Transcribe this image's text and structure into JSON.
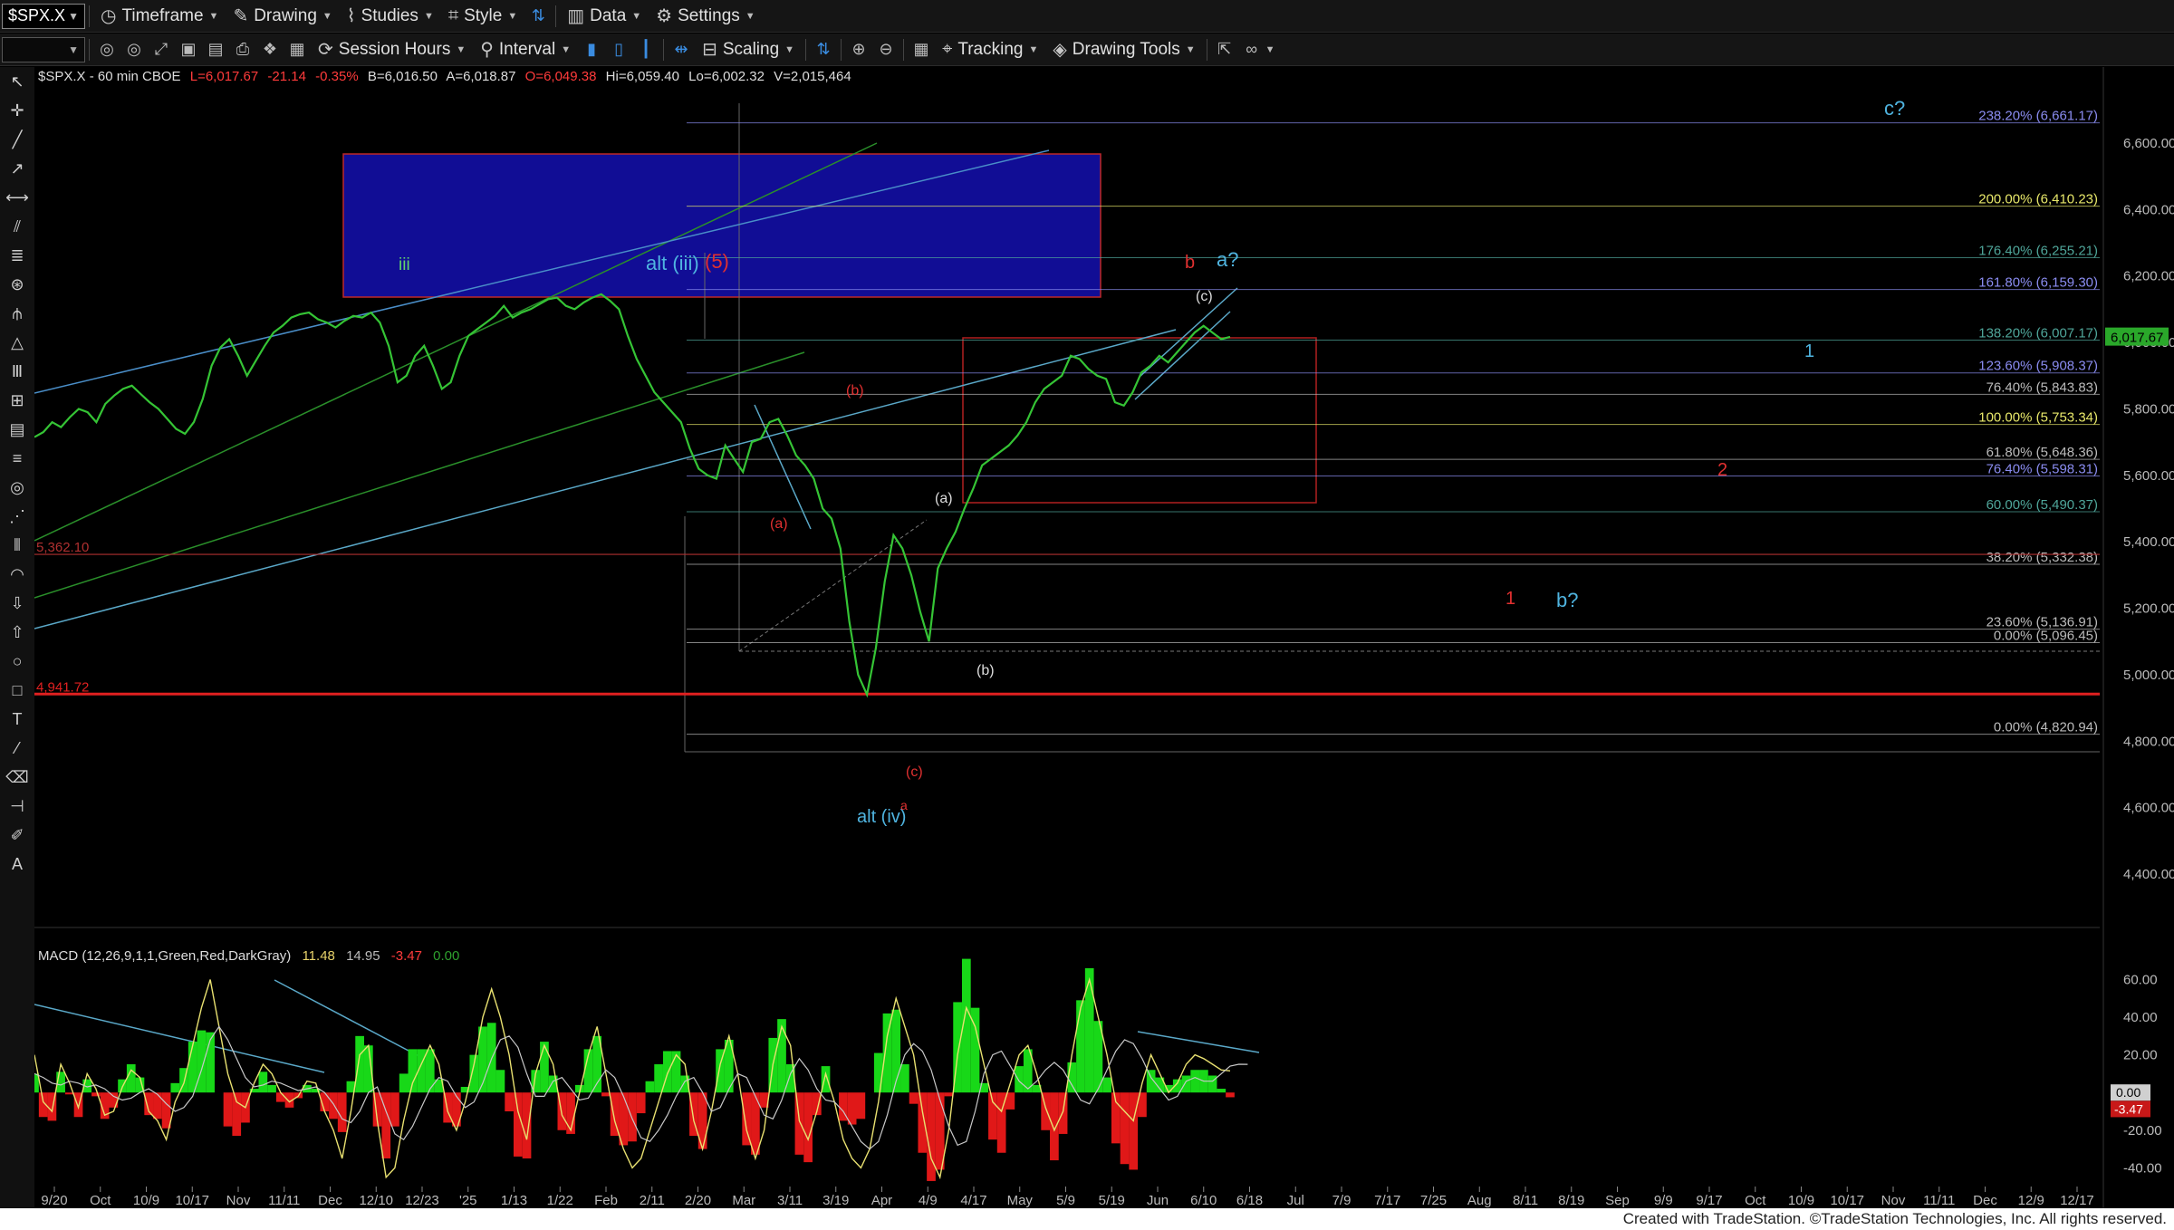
{
  "toolbar1": {
    "symbol": "$SPX.X",
    "buttons": [
      {
        "label": "Timeframe",
        "icon": "clock-icon"
      },
      {
        "label": "Drawing",
        "icon": "pencil-icon"
      },
      {
        "label": "Studies",
        "icon": "chart-line-icon"
      },
      {
        "label": "Style",
        "icon": "style-icon"
      },
      {
        "label": "Data",
        "icon": "bar-chart-icon"
      },
      {
        "label": "Settings",
        "icon": "gear-icon"
      }
    ]
  },
  "toolbar2": {
    "buttons": [
      {
        "label": "Session Hours",
        "icon": "sync-icon"
      },
      {
        "label": "Interval",
        "icon": "interval-icon"
      },
      {
        "label": "Scaling",
        "icon": "scaling-icon"
      },
      {
        "label": "Tracking",
        "icon": "crosshair-icon"
      },
      {
        "label": "Drawing Tools",
        "icon": "drawing-tools-icon"
      }
    ]
  },
  "header": {
    "title": "$SPX.X - 60 min  CBOE",
    "last": "L=6,017.67",
    "change": "-21.14",
    "pct": "-0.35%",
    "bid": "B=6,016.50",
    "ask": "A=6,018.87",
    "open": "O=6,049.38",
    "high": "Hi=6,059.40",
    "low": "Lo=6,002.32",
    "volume": "V=2,015,464"
  },
  "macd_header": {
    "label": "MACD (12,26,9,1,1,Green,Red,DarkGray)",
    "v1": "11.48",
    "v2": "14.95",
    "v3": "-3.47",
    "v4": "0.00"
  },
  "chart_data": {
    "type": "line",
    "title": "",
    "xlabel": "",
    "ylabel": "",
    "price_axis": {
      "ylim": [
        4250,
        6720
      ],
      "ticks": [
        "6,600.00",
        "6,400.00",
        "6,200.00",
        "6,000.00",
        "5,800.00",
        "5,600.00",
        "5,400.00",
        "5,200.00",
        "5,000.00",
        "4,800.00",
        "4,600.00",
        "4,400.00"
      ],
      "last_price_label": "6,017.67"
    },
    "macd_axis": {
      "ylim": [
        -48,
        66
      ],
      "ticks": [
        "60.00",
        "40.00",
        "20.00",
        "0.00",
        "-20.00",
        "-40.00"
      ],
      "macd_label": "0.00",
      "hist_label": "-3.47"
    },
    "x_ticks": [
      "9/20",
      "Oct",
      "10/9",
      "10/17",
      "Nov",
      "11/11",
      "Dec",
      "12/10",
      "12/23",
      "'25",
      "1/13",
      "1/22",
      "Feb",
      "2/11",
      "2/20",
      "Mar",
      "3/11",
      "3/19",
      "Apr",
      "4/9",
      "4/17",
      "May",
      "5/9",
      "5/19",
      "Jun",
      "6/10",
      "6/18",
      "Jul",
      "7/9",
      "7/17",
      "7/25",
      "Aug",
      "8/11",
      "8/19",
      "Sep",
      "9/9",
      "9/17",
      "Oct",
      "10/9",
      "10/17",
      "Nov",
      "11/11",
      "Dec",
      "12/9",
      "12/17"
    ],
    "series": [
      {
        "values": [
          5715,
          5730,
          5760,
          5745,
          5775,
          5800,
          5790,
          5760,
          5815,
          5840,
          5860,
          5870,
          5845,
          5820,
          5800,
          5770,
          5740,
          5725,
          5760,
          5830,
          5930,
          5985,
          6010,
          5960,
          5900,
          5945,
          5990,
          6030,
          6050,
          6075,
          6085,
          6090,
          6070,
          6060,
          6045,
          6065,
          6080,
          6075,
          6090,
          6060,
          5990,
          5880,
          5900,
          5960,
          5990,
          5930,
          5860,
          5880,
          5960,
          6020,
          6040,
          6060,
          6080,
          6110,
          6075,
          6090,
          6100,
          6115,
          6130,
          6135,
          6110,
          6100,
          6120,
          6135,
          6145,
          6125,
          6100,
          6020,
          5950,
          5900,
          5850,
          5820,
          5790,
          5760,
          5680,
          5620,
          5600,
          5590,
          5690,
          5650,
          5610,
          5700,
          5710,
          5760,
          5770,
          5720,
          5660,
          5630,
          5590,
          5500,
          5470,
          5380,
          5160,
          5000,
          4940,
          5080,
          5280,
          5420,
          5380,
          5300,
          5190,
          5100,
          5320,
          5380,
          5430,
          5500,
          5560,
          5630,
          5650,
          5670,
          5690,
          5720,
          5760,
          5820,
          5860,
          5880,
          5900,
          5960,
          5950,
          5920,
          5900,
          5890,
          5820,
          5810,
          5850,
          5910,
          5930,
          5960,
          5940,
          5970,
          6000,
          6030,
          6050,
          6030,
          6010,
          6017
        ]
      },
      {
        "values": [
          20,
          -5,
          -10,
          15,
          5,
          -8,
          10,
          2,
          -12,
          -10,
          3,
          12,
          8,
          -10,
          -15,
          -25,
          -5,
          5,
          25,
          45,
          60,
          35,
          10,
          -5,
          -8,
          5,
          15,
          10,
          0,
          -5,
          -2,
          6,
          5,
          -10,
          -20,
          -35,
          -10,
          20,
          25,
          -15,
          -45,
          -40,
          -15,
          5,
          15,
          25,
          15,
          -10,
          -20,
          -5,
          15,
          40,
          55,
          40,
          20,
          -10,
          -25,
          10,
          25,
          15,
          -12,
          -20,
          0,
          20,
          35,
          10,
          -15,
          -30,
          -40,
          -35,
          -20,
          -5,
          10,
          20,
          15,
          -15,
          -30,
          -10,
          15,
          30,
          10,
          -20,
          -35,
          -20,
          15,
          35,
          25,
          -15,
          -25,
          -10,
          10,
          -5,
          -25,
          -35,
          -40,
          -30,
          -5,
          30,
          50,
          35,
          20,
          -10,
          -35,
          -45,
          -20,
          20,
          45,
          35,
          15,
          -5,
          -10,
          5,
          20,
          25,
          10,
          -8,
          -20,
          -10,
          20,
          45,
          60,
          40,
          20,
          -5,
          -10,
          -15,
          5,
          20,
          10,
          0,
          5,
          15,
          20,
          18,
          15,
          12,
          11.48
        ]
      },
      {
        "values": [
          10,
          8,
          5,
          4,
          6,
          5,
          3,
          4,
          2,
          -2,
          -4,
          -3,
          0,
          2,
          -1,
          -6,
          -10,
          -8,
          -2,
          12,
          28,
          35,
          28,
          18,
          8,
          3,
          4,
          6,
          5,
          3,
          1,
          2,
          3,
          0,
          -6,
          -14,
          -16,
          -10,
          0,
          3,
          -10,
          -22,
          -25,
          -18,
          -8,
          2,
          8,
          6,
          -2,
          -8,
          -5,
          5,
          18,
          28,
          30,
          24,
          10,
          -2,
          -2,
          6,
          8,
          2,
          -4,
          -3,
          5,
          12,
          8,
          -2,
          -14,
          -24,
          -26,
          -20,
          -12,
          -2,
          6,
          8,
          0,
          -10,
          -8,
          2,
          10,
          8,
          -2,
          -12,
          -14,
          -4,
          10,
          18,
          12,
          2,
          -4,
          -5,
          -10,
          -18,
          -26,
          -30,
          -26,
          -12,
          6,
          20,
          26,
          22,
          12,
          -4,
          -18,
          -28,
          -26,
          -10,
          10,
          20,
          22,
          14,
          6,
          2,
          6,
          12,
          16,
          12,
          4,
          -4,
          -6,
          2,
          12,
          22,
          28,
          26,
          18,
          8,
          2,
          -4,
          -2,
          6,
          8,
          6,
          6,
          10,
          14,
          15,
          14.95
        ]
      }
    ],
    "fib_levels": [
      {
        "text": "238.20% (6,661.17)",
        "color": "#8a8cf0"
      },
      {
        "text": "200.00% (6,410.23)",
        "color": "#e8e86a"
      },
      {
        "text": "176.40% (6,255.21)",
        "color": "#4fa69a"
      },
      {
        "text": "161.80% (6,159.30)",
        "color": "#8a8cf0"
      },
      {
        "text": "138.20% (6,007.17)",
        "color": "#4fa69a"
      },
      {
        "text": "123.60% (5,908.37)",
        "color": "#8a8cf0"
      },
      {
        "text": "76.40% (5,843.83)",
        "color": "#bbbbbb"
      },
      {
        "text": "100.00% (5,753.34)",
        "color": "#e8e86a"
      },
      {
        "text": "61.80% (5,648.36)",
        "color": "#bbbbbb"
      },
      {
        "text": "76.40% (5,598.31)",
        "color": "#8a8cf0"
      },
      {
        "text": "60.00% (5,490.37)",
        "color": "#4fa69a"
      },
      {
        "text": "38.20% (5,332.38)",
        "color": "#bbbbbb"
      },
      {
        "text": "23.60% (5,136.91)",
        "color": "#bbbbbb"
      },
      {
        "text": "0.00% (5,096.45)",
        "color": "#bbbbbb"
      },
      {
        "text": "0.00% (4,820.94)",
        "color": "#bbbbbb"
      }
    ],
    "horizontal_lines": [
      {
        "label": "5,362.10",
        "color": "#b03030"
      },
      {
        "label": "4,941.72",
        "color": "#e02020"
      }
    ],
    "wave_labels": [
      {
        "text": "iii",
        "color": "#62d36e"
      },
      {
        "text": "alt (iii)",
        "color": "#4fb4e0"
      },
      {
        "text": "(5)",
        "color": "#e03030"
      },
      {
        "text": "(b)",
        "color": "#e03030"
      },
      {
        "text": "(a)",
        "color": "#e03030"
      },
      {
        "text": "(a)",
        "color": "#dddddd"
      },
      {
        "text": "(b)",
        "color": "#dddddd"
      },
      {
        "text": "(c)",
        "color": "#e03030"
      },
      {
        "text": "alt (iv)",
        "color": "#4fb4e0"
      },
      {
        "text": "a",
        "color": "#e03030"
      },
      {
        "text": "b",
        "color": "#e03030"
      },
      {
        "text": "a?",
        "color": "#4fb4e0"
      },
      {
        "text": "(c)",
        "color": "#dddddd"
      },
      {
        "text": "1",
        "color": "#4fb4e0"
      },
      {
        "text": "2",
        "color": "#e03030"
      },
      {
        "text": "1",
        "color": "#e03030"
      },
      {
        "text": "b?",
        "color": "#4fb4e0"
      },
      {
        "text": "c?",
        "color": "#4fb4e0"
      }
    ]
  },
  "status_bar": {
    "text": "Created with TradeStation. ©TradeStation Technologies, Inc. All rights reserved."
  }
}
